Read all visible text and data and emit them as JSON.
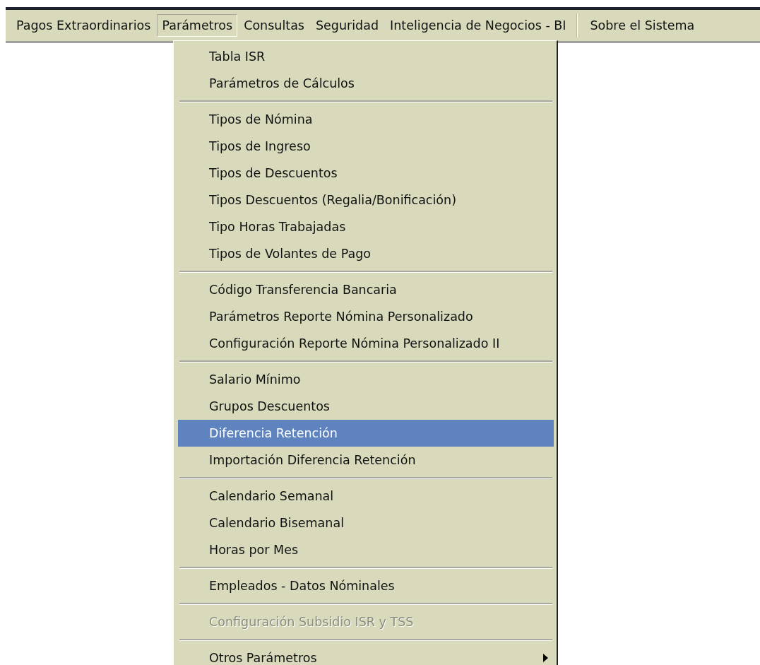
{
  "menubar": {
    "items": [
      {
        "label": "Pagos Extraordinarios",
        "selected": false,
        "divider_before": false
      },
      {
        "label": "Parámetros",
        "selected": true,
        "divider_before": false
      },
      {
        "label": "Consultas",
        "selected": false,
        "divider_before": false
      },
      {
        "label": "Seguridad",
        "selected": false,
        "divider_before": false
      },
      {
        "label": "Inteligencia de Negocios - BI",
        "selected": false,
        "divider_before": false
      },
      {
        "label": "Sobre el Sistema",
        "selected": false,
        "divider_before": true
      }
    ]
  },
  "menu": {
    "groups": [
      [
        {
          "label": "Tabla  ISR",
          "selected": false,
          "disabled": false,
          "submenu": false
        },
        {
          "label": "Parámetros de Cálculos",
          "selected": false,
          "disabled": false,
          "submenu": false
        }
      ],
      [
        {
          "label": "Tipos de Nómina",
          "selected": false,
          "disabled": false,
          "submenu": false
        },
        {
          "label": "Tipos de Ingreso",
          "selected": false,
          "disabled": false,
          "submenu": false
        },
        {
          "label": "Tipos de Descuentos",
          "selected": false,
          "disabled": false,
          "submenu": false
        },
        {
          "label": "Tipos Descuentos (Regalia/Bonificación)",
          "selected": false,
          "disabled": false,
          "submenu": false
        },
        {
          "label": "Tipo Horas Trabajadas",
          "selected": false,
          "disabled": false,
          "submenu": false
        },
        {
          "label": "Tipos de Volantes de Pago",
          "selected": false,
          "disabled": false,
          "submenu": false
        }
      ],
      [
        {
          "label": "Código Transferencia Bancaria",
          "selected": false,
          "disabled": false,
          "submenu": false
        },
        {
          "label": "Parámetros Reporte Nómina Personalizado",
          "selected": false,
          "disabled": false,
          "submenu": false
        },
        {
          "label": "Configuración Reporte Nómina Personalizado II",
          "selected": false,
          "disabled": false,
          "submenu": false
        }
      ],
      [
        {
          "label": "Salario Mínimo",
          "selected": false,
          "disabled": false,
          "submenu": false
        },
        {
          "label": "Grupos Descuentos",
          "selected": false,
          "disabled": false,
          "submenu": false
        },
        {
          "label": "Diferencia Retención",
          "selected": true,
          "disabled": false,
          "submenu": false
        },
        {
          "label": "Importación Diferencia Retención",
          "selected": false,
          "disabled": false,
          "submenu": false
        }
      ],
      [
        {
          "label": "Calendario Semanal",
          "selected": false,
          "disabled": false,
          "submenu": false
        },
        {
          "label": "Calendario Bisemanal",
          "selected": false,
          "disabled": false,
          "submenu": false
        },
        {
          "label": "Horas por Mes",
          "selected": false,
          "disabled": false,
          "submenu": false
        }
      ],
      [
        {
          "label": "Empleados - Datos Nóminales",
          "selected": false,
          "disabled": false,
          "submenu": false
        }
      ],
      [
        {
          "label": "Configuración Subsidio ISR y TSS",
          "selected": false,
          "disabled": true,
          "submenu": false
        }
      ],
      [
        {
          "label": "Otros Parámetros",
          "selected": false,
          "disabled": false,
          "submenu": true
        }
      ]
    ]
  }
}
